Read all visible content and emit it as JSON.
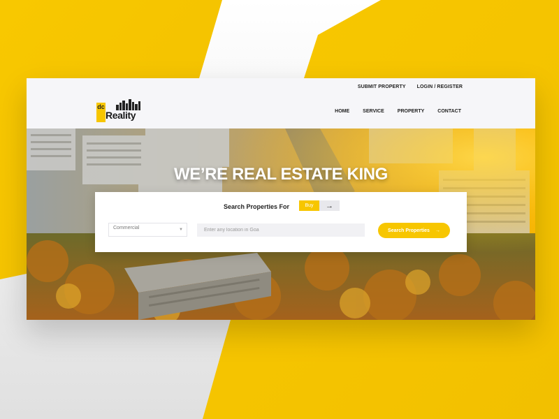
{
  "colors": {
    "accent": "#f7c600",
    "dark": "#222222",
    "header_bg": "#f6f6f9"
  },
  "header": {
    "top_links": [
      "SUBMIT PROPERTY",
      "LOGIN / REGISTER"
    ],
    "logo": {
      "mark": "dc",
      "text": "Reality",
      "icon": "city-skyline-icon"
    },
    "nav": [
      "HOME",
      "SERVICE",
      "PROPERTY",
      "CONTACT"
    ]
  },
  "hero": {
    "title": "WE’RE REAL ESTATE KING",
    "search": {
      "heading": "Search Properties For",
      "toggle": {
        "active": "Buy",
        "other_icon": "arrow-right-icon"
      },
      "type_select": {
        "value": "Commercial",
        "icon": "chevron-down-icon"
      },
      "location": {
        "value": "",
        "placeholder": "Enter any location in Goa"
      },
      "submit_label": "Search Properties",
      "submit_icon": "arrow-right-icon"
    }
  }
}
